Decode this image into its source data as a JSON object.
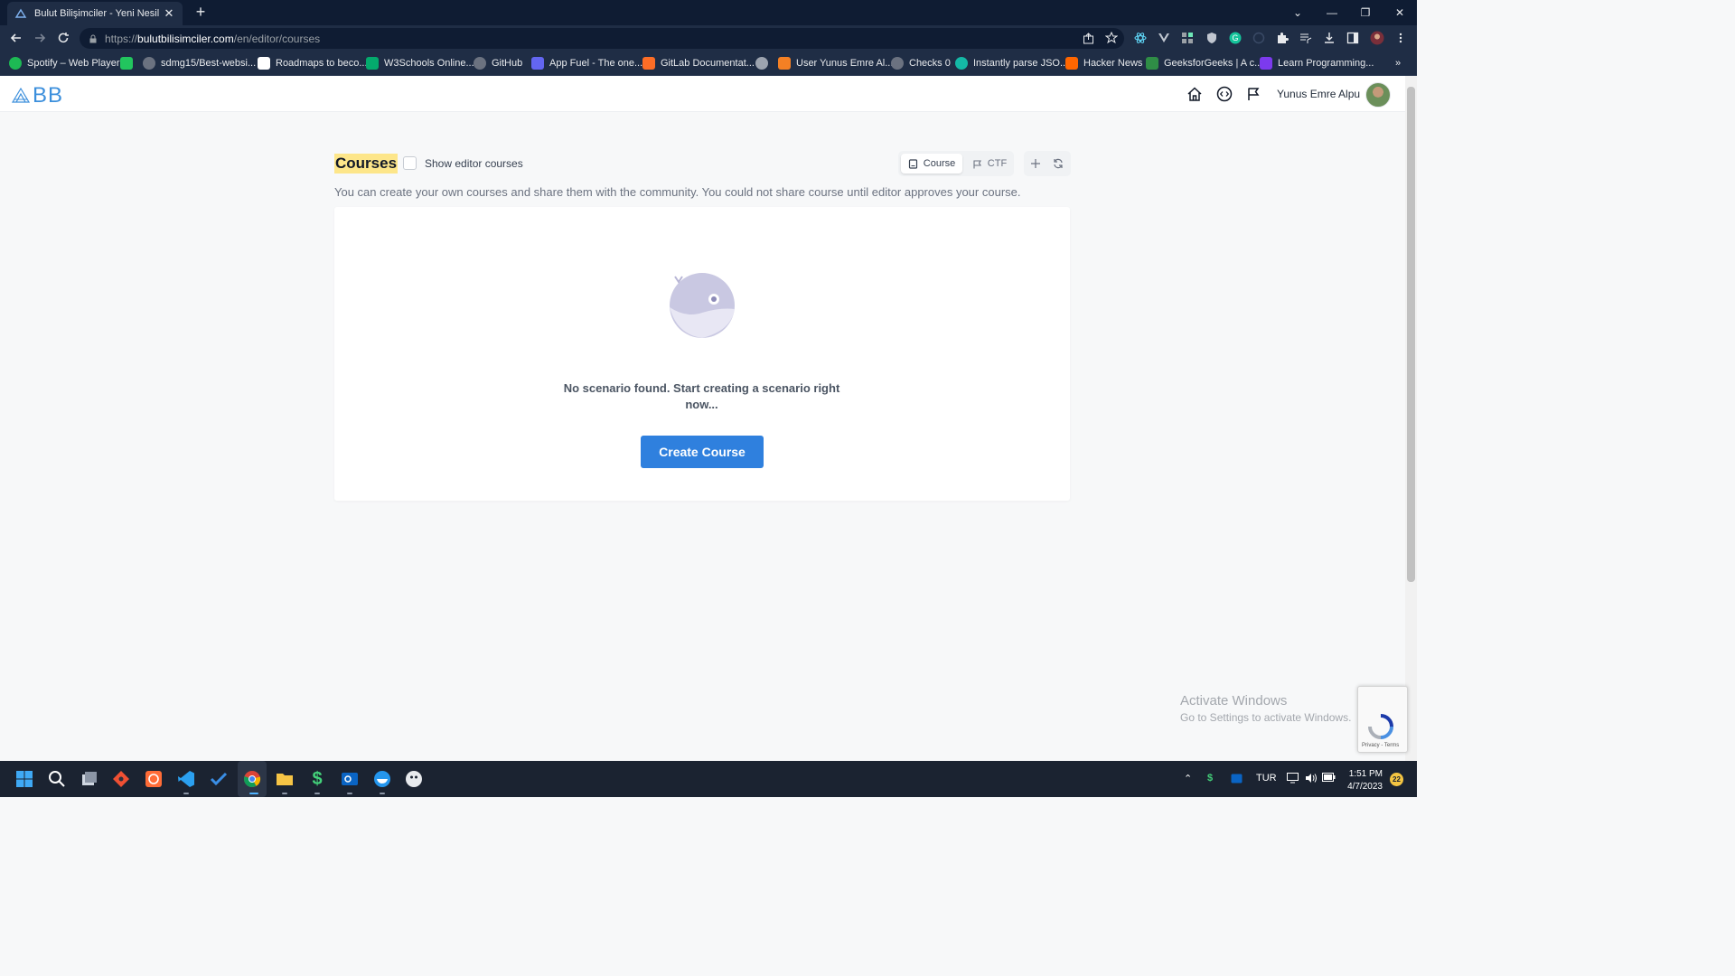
{
  "browser": {
    "tab_title": "Bulut Bilişimciler - Yeni Nesil Plat",
    "url_protocol": "https://",
    "url_host": "bulutbilisimciler.com",
    "url_path": "/en/editor/courses",
    "bookmarks": [
      {
        "label": "Spotify – Web Player",
        "color": "#1db954"
      },
      {
        "label": "",
        "color": "#22c55e"
      },
      {
        "label": "sdmg15/Best-websi...",
        "color": "#6b7280"
      },
      {
        "label": "Roadmaps to beco...",
        "color": "#ffffff"
      },
      {
        "label": "W3Schools Online...",
        "color": "#04aa6d"
      },
      {
        "label": "GitHub",
        "color": "#6b7280"
      },
      {
        "label": "App Fuel - The one...",
        "color": "#6366f1"
      },
      {
        "label": "GitLab Documentat...",
        "color": "#fc6d26"
      },
      {
        "label": "",
        "color": "#9ca3af"
      },
      {
        "label": "User Yunus Emre Al...",
        "color": "#f48024"
      },
      {
        "label": "Checks 0",
        "color": "#6b7280"
      },
      {
        "label": "Instantly parse JSO...",
        "color": "#14b8a6"
      },
      {
        "label": "Hacker News",
        "color": "#ff6600"
      },
      {
        "label": "GeeksforGeeks | A c...",
        "color": "#2f8d46"
      },
      {
        "label": "Learn Programming...",
        "color": "#7c3aed"
      }
    ],
    "overflow": "»"
  },
  "header": {
    "logo_text": "BB",
    "username": "Yunus Emre Alpu",
    "icons": [
      "home-icon",
      "code-icon",
      "flag-icon"
    ]
  },
  "courses": {
    "title": "Courses",
    "show_editor_label": "Show editor courses",
    "segment_course": "Course",
    "segment_ctf": "CTF",
    "description": "You can create your own courses and share them with the community. You could not share course until editor approves your course.",
    "empty_message": "No scenario found. Start creating a scenario right now...",
    "create_button": "Create Course"
  },
  "watermark": {
    "line1": "Activate Windows",
    "line2": "Go to Settings to activate Windows."
  },
  "recaptcha": {
    "text": "Privacy - Terms"
  },
  "taskbar": {
    "language": "TUR",
    "time": "1:51 PM",
    "date": "4/7/2023",
    "notifications": "22"
  },
  "colors": {
    "accent": "#2f80de",
    "title_highlight": "#fde68a",
    "chrome_dark": "#0f1c33"
  }
}
